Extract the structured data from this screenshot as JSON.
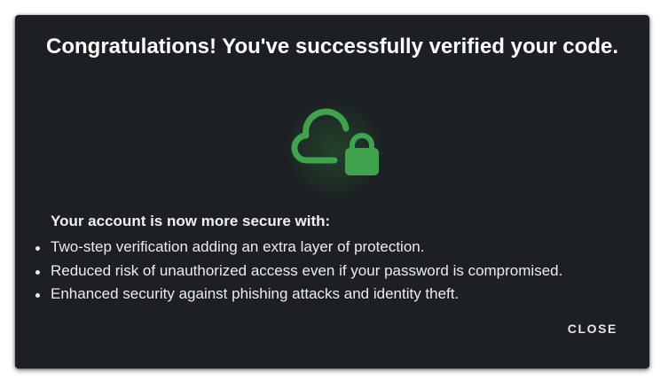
{
  "dialog": {
    "title": "Congratulations! You've successfully verified your code.",
    "icon": "cloud-lock-icon",
    "accent_color": "#3fa34d",
    "background_color": "#1c1f23",
    "secure_heading": "Your account is now more secure with:",
    "benefits": [
      "Two-step verification adding an extra layer of protection.",
      "Reduced risk of unauthorized access even if your password is compromised.",
      "Enhanced security against phishing attacks and identity theft."
    ],
    "close_label": "CLOSE"
  }
}
